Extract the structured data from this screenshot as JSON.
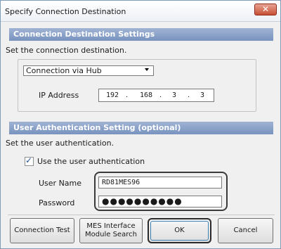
{
  "window": {
    "title": "Specify Connection Destination",
    "close_glyph": "✕"
  },
  "connection": {
    "header": "Connection Destination Settings",
    "description": "Set the connection destination.",
    "dropdown_value": "Connection via Hub",
    "ip_label": "IP Address",
    "ip_octets": [
      "192",
      "168",
      "3",
      "3"
    ]
  },
  "auth": {
    "header": "User Authentication Setting (optional)",
    "description": "Set the user authentication.",
    "checkbox_label": "Use the user authentication",
    "checkbox_checked": true,
    "checkmark": "✓",
    "username_label": "User Name",
    "username_value": "RD81MES96",
    "password_label": "Password",
    "password_mask": "●●●●●●●●●●"
  },
  "buttons": {
    "connection_test": "Connection Test",
    "mes_search_line1": "MES Interface",
    "mes_search_line2": "Module Search",
    "ok": "OK",
    "cancel": "Cancel"
  }
}
